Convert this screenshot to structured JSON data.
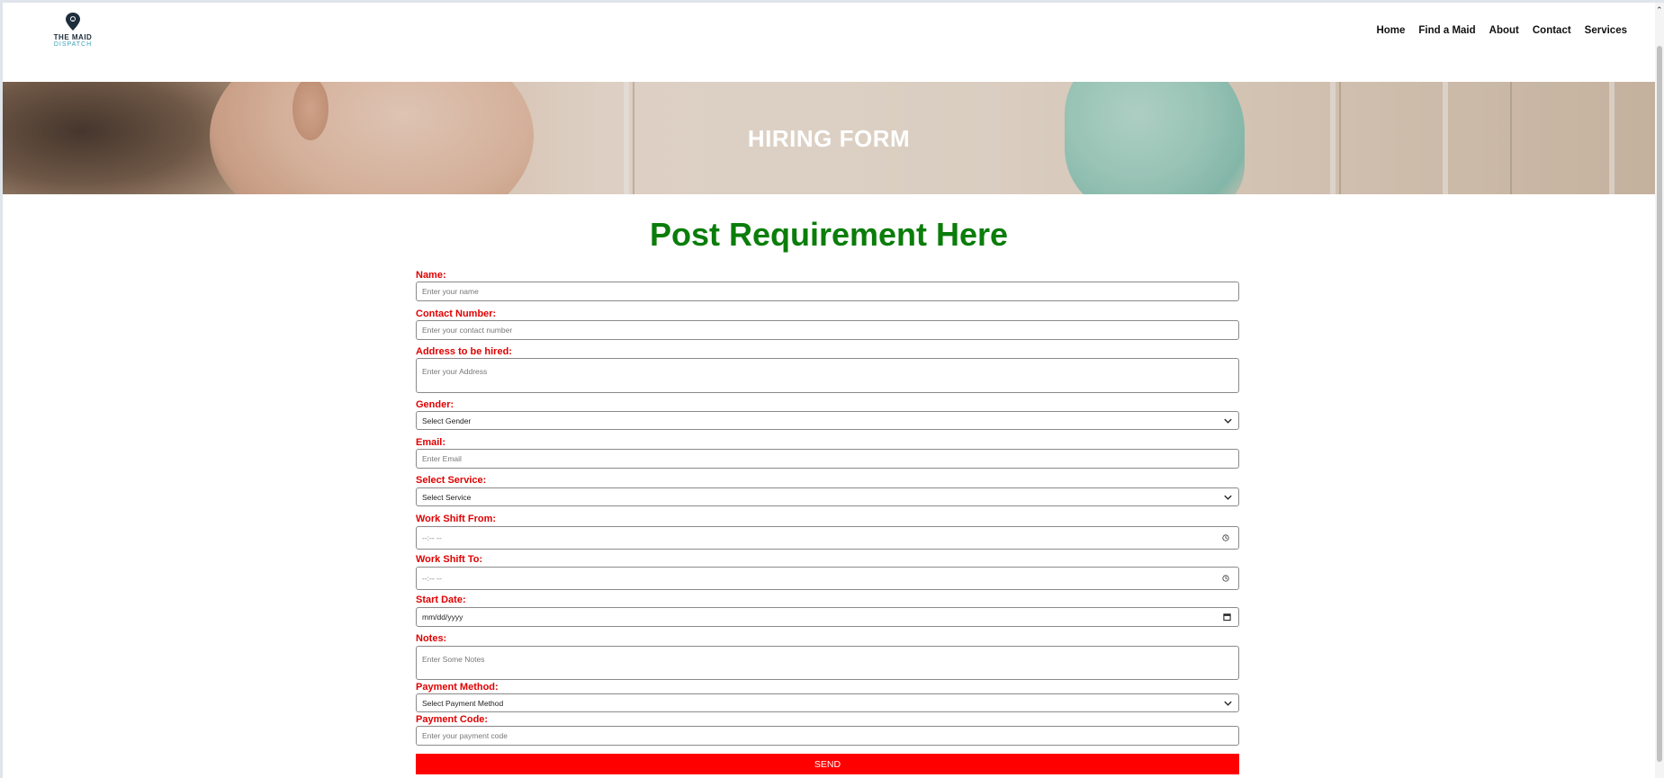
{
  "brand": {
    "logo_line1": "THE MAID",
    "logo_line2": "DISPATCH"
  },
  "nav": {
    "items": [
      "Home",
      "Find a Maid",
      "About",
      "Contact",
      "Services"
    ]
  },
  "banner": {
    "title": "HIRING FORM"
  },
  "form": {
    "title": "Post Requirement Here",
    "name_label": "Name:",
    "name_placeholder": "Enter your name",
    "contact_label": "Contact Number:",
    "contact_placeholder": "Enter your contact number",
    "address_label": "Address to be hired:",
    "address_placeholder": "Enter your Address",
    "gender_label": "Gender:",
    "gender_value": "Select Gender",
    "email_label": "Email:",
    "email_placeholder": "Enter Email",
    "service_label": "Select Service:",
    "service_value": "Select Service",
    "shift_from_label": "Work Shift From:",
    "shift_from_value": "--:-- --",
    "shift_to_label": "Work Shift To:",
    "shift_to_value": "--:-- --",
    "start_date_label": "Start Date:",
    "start_date_value": "mm/dd/yyyy",
    "notes_label": "Notes:",
    "notes_placeholder": "Enter Some Notes",
    "payment_method_label": "Payment Method:",
    "payment_method_value": "Select Payment Method",
    "payment_code_label": "Payment Code:",
    "payment_code_placeholder": "Enter your payment code",
    "send_label": "SEND"
  },
  "colors": {
    "title_green": "#0a7d0a",
    "label_red": "#e00000",
    "button_red": "#ff0000"
  }
}
